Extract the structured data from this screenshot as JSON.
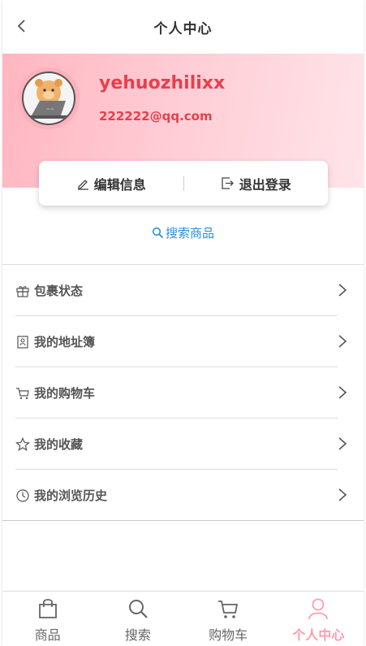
{
  "header": {
    "title": "个人中心"
  },
  "profile": {
    "username": "yehuozhilixx",
    "email": "222222@qq.com"
  },
  "actions": {
    "edit_label": "编辑信息",
    "logout_label": "退出登录"
  },
  "search_link": {
    "label": "搜索商品"
  },
  "menu": {
    "items": [
      {
        "label": "包裹状态",
        "icon": "gift-icon"
      },
      {
        "label": "我的地址簿",
        "icon": "address-book-icon"
      },
      {
        "label": "我的购物车",
        "icon": "cart-icon"
      },
      {
        "label": "我的收藏",
        "icon": "star-icon"
      },
      {
        "label": "我的浏览历史",
        "icon": "clock-icon"
      }
    ]
  },
  "tabbar": {
    "items": [
      {
        "label": "商品",
        "icon": "shopping-bag-icon",
        "active": false
      },
      {
        "label": "搜索",
        "icon": "search-icon",
        "active": false
      },
      {
        "label": "购物车",
        "icon": "cart-icon",
        "active": false
      },
      {
        "label": "个人中心",
        "icon": "user-icon",
        "active": true
      }
    ]
  },
  "colors": {
    "accent": "#e5404d",
    "link": "#2a8fd6",
    "active_tab": "#ff9cae",
    "banner_start": "#ffb6c1"
  }
}
